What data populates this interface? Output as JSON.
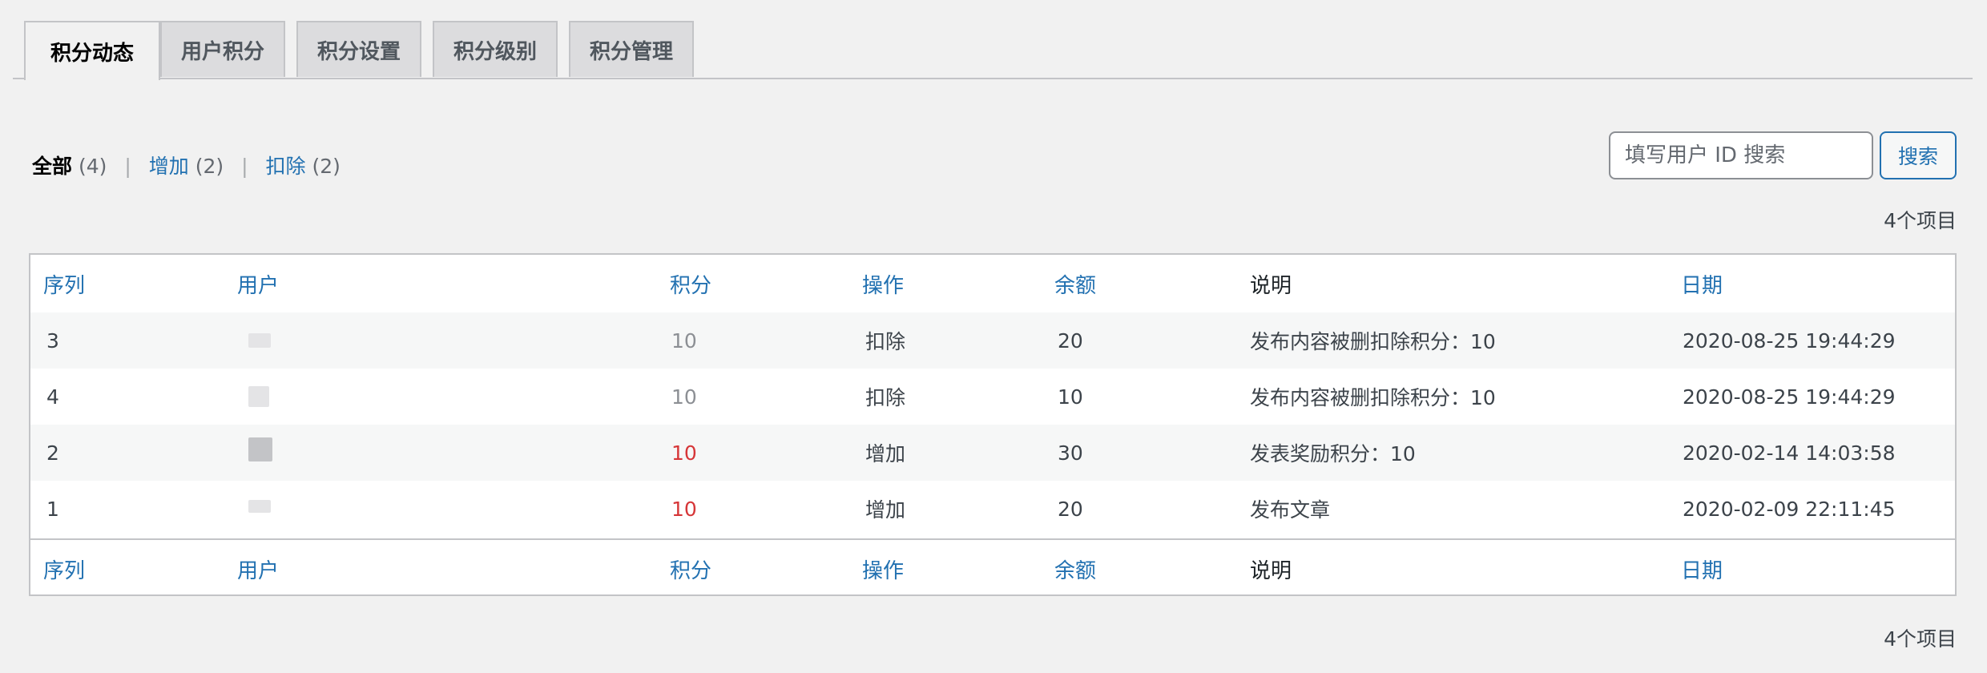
{
  "tabs": [
    {
      "label": "积分动态",
      "active": true
    },
    {
      "label": "用户积分",
      "active": false
    },
    {
      "label": "积分设置",
      "active": false
    },
    {
      "label": "积分级别",
      "active": false
    },
    {
      "label": "积分管理",
      "active": false
    }
  ],
  "filters": {
    "all_label": "全部",
    "all_count": "(4)",
    "add_label": "增加",
    "add_count": "(2)",
    "deduct_label": "扣除",
    "deduct_count": "(2)",
    "separator": "|"
  },
  "search": {
    "placeholder": "填写用户 ID 搜索",
    "value": "",
    "button_label": "搜索"
  },
  "item_count": "4个项目",
  "table": {
    "columns": [
      "序列",
      "用户",
      "积分",
      "操作",
      "余额",
      "说明",
      "日期"
    ],
    "rows": [
      {
        "id": "3",
        "user": "",
        "points": "10",
        "action": "扣除",
        "balance": "20",
        "note": "发布内容被删扣除积分：10",
        "date": "2020-08-25 19:44:29"
      },
      {
        "id": "4",
        "user": "",
        "points": "10",
        "action": "扣除",
        "balance": "10",
        "note": "发布内容被删扣除积分：10",
        "date": "2020-08-25 19:44:29"
      },
      {
        "id": "2",
        "user": "",
        "points": "10",
        "action": "增加",
        "balance": "30",
        "note": "发表奖励积分：10",
        "date": "2020-02-14 14:03:58"
      },
      {
        "id": "1",
        "user": "",
        "points": "10",
        "action": "增加",
        "balance": "20",
        "note": "发布文章",
        "date": "2020-02-09 22:11:45"
      }
    ]
  },
  "colors": {
    "link": "#2271b1",
    "deduct_points": "#8c8f94",
    "add_points": "#d63638"
  }
}
